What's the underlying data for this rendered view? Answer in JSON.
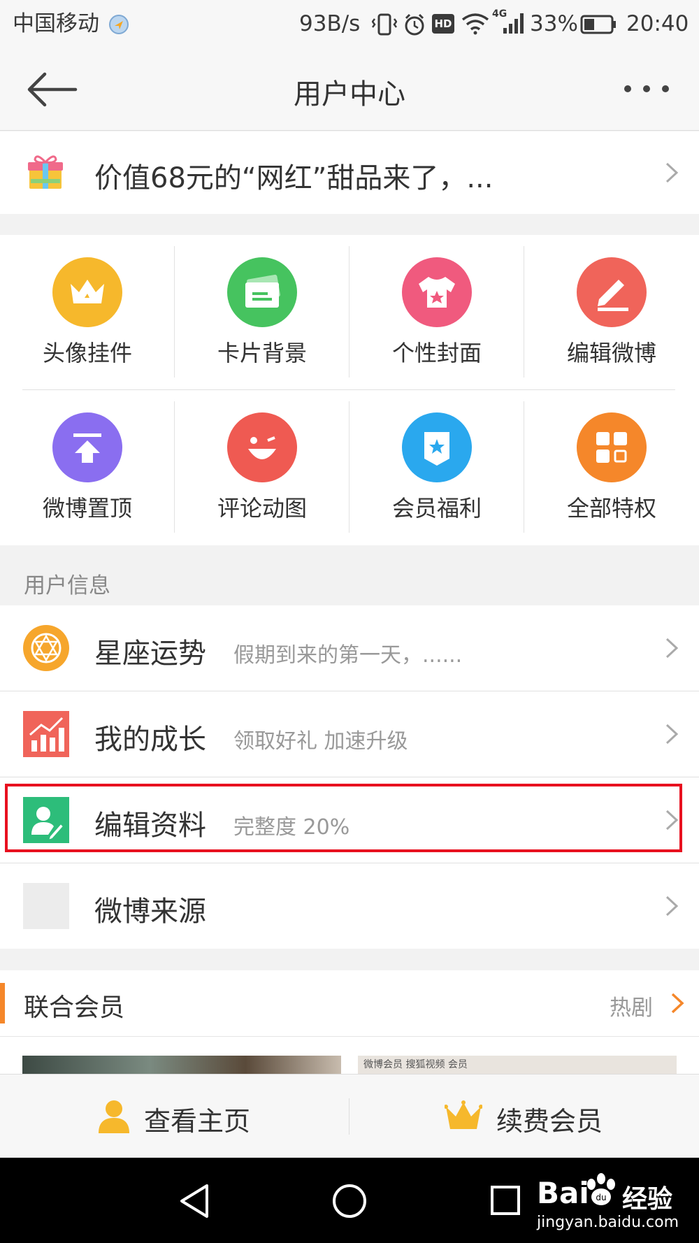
{
  "status_bar": {
    "carrier": "中国移动",
    "speed": "93B/s",
    "network": "4G",
    "battery": "33%",
    "time": "20:40",
    "hd_badge": "HD"
  },
  "nav": {
    "title": "用户中心"
  },
  "banner": {
    "text": "价值68元的“网红”甜品来了，..."
  },
  "grid": [
    {
      "label": "头像挂件",
      "icon": "crown-icon",
      "color": "#f6b82c"
    },
    {
      "label": "卡片背景",
      "icon": "card-icon",
      "color": "#46c35f"
    },
    {
      "label": "个性封面",
      "icon": "shirt-icon",
      "color": "#f05a7e"
    },
    {
      "label": "编辑微博",
      "icon": "pencil-icon",
      "color": "#f0645a"
    },
    {
      "label": "微博置顶",
      "icon": "pin-top-icon",
      "color": "#8a6ef0"
    },
    {
      "label": "评论动图",
      "icon": "smile-icon",
      "color": "#ef5a52"
    },
    {
      "label": "会员福利",
      "icon": "badge-star-icon",
      "color": "#2aa8ee"
    },
    {
      "label": "全部特权",
      "icon": "grid-icon",
      "color": "#f5872a"
    }
  ],
  "section": {
    "user_info": "用户信息"
  },
  "rows": [
    {
      "title": "星座运势",
      "subtitle": "假期到来的第一天，......",
      "icon": "constellation-icon"
    },
    {
      "title": "我的成长",
      "subtitle": "领取好礼  加速升级",
      "icon": "growth-chart-icon"
    },
    {
      "title": "编辑资料",
      "subtitle": "完整度 20%",
      "icon": "edit-profile-icon"
    },
    {
      "title": "微博来源",
      "subtitle": "",
      "icon": "placeholder-icon"
    }
  ],
  "lianhe": {
    "title": "联合会员",
    "right": "热剧",
    "thumb_text": "微博会员  搜狐视频  会员"
  },
  "bottom_bar": {
    "view_home": "查看主页",
    "renew": "续费会员"
  },
  "watermark": {
    "brand": "Bai",
    "brand_cn": "经验",
    "url": "jingyan.baidu.com"
  },
  "colors": {
    "accent_orange": "#f5872a",
    "highlight_red": "#e8101f"
  }
}
